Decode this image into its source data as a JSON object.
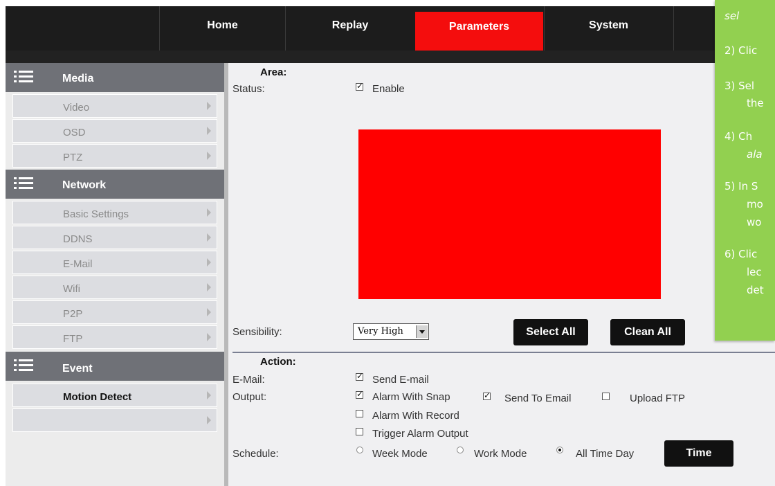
{
  "nav": {
    "tabs": [
      {
        "label": "Home"
      },
      {
        "label": "Replay"
      },
      {
        "label": "Parameters"
      },
      {
        "label": "System"
      }
    ]
  },
  "sidebar": {
    "media": {
      "label": "Media",
      "items": [
        {
          "label": "Video"
        },
        {
          "label": "OSD"
        },
        {
          "label": "PTZ"
        }
      ]
    },
    "network": {
      "label": "Network",
      "items": [
        {
          "label": "Basic Settings"
        },
        {
          "label": "DDNS"
        },
        {
          "label": "E-Mail"
        },
        {
          "label": "Wifi"
        },
        {
          "label": "P2P"
        },
        {
          "label": "FTP"
        }
      ]
    },
    "event": {
      "label": "Event",
      "items": [
        {
          "label": "Motion Detect"
        }
      ]
    }
  },
  "area": {
    "heading": "Area:",
    "status_label": "Status:",
    "enable_label": "Enable",
    "sensibility_label": "Sensibility:",
    "sensibility_value": "Very High",
    "select_all": "Select All",
    "clean_all": "Clean All",
    "region_color": "#ff0000"
  },
  "action": {
    "heading": "Action:",
    "email_label": "E-Mail:",
    "send_email": "Send E-mail",
    "output_label": "Output:",
    "alarm_with_snap": "Alarm With Snap",
    "send_to_email": "Send To Email",
    "upload_ftp": "Upload FTP",
    "alarm_with_record": "Alarm With Record",
    "trigger_alarm_output": "Trigger Alarm Output",
    "schedule_label": "Schedule:",
    "week_mode": "Week Mode",
    "work_mode": "Work Mode",
    "all_time_day": "All Time Day",
    "time_button": "Time"
  },
  "instructions": {
    "lines": [
      "sel",
      "2)   Clic",
      "3)   Sel",
      "the",
      "4)   Ch",
      "ala",
      "5)   In S",
      "mo",
      "wo",
      "6)   Clic",
      "lec",
      "det"
    ]
  },
  "colors": {
    "active_tab": "#f40d0d",
    "panel": "#92d050"
  }
}
